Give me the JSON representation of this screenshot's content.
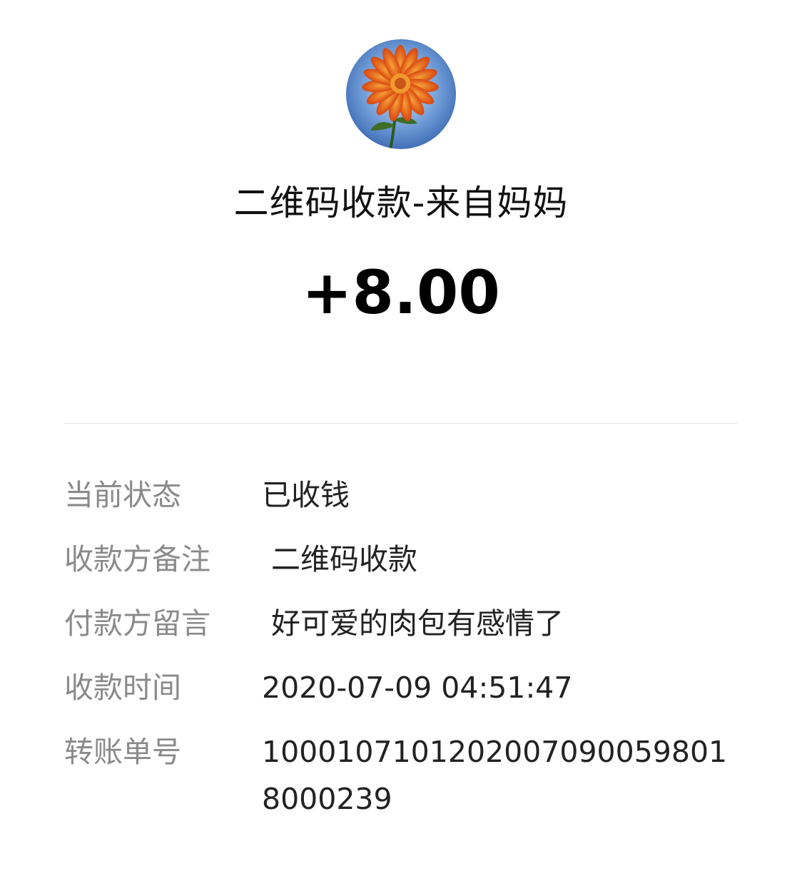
{
  "header": {
    "avatar_icon": "flower-avatar-icon",
    "title": "二维码收款-来自妈妈",
    "amount": "+8.00"
  },
  "details": [
    {
      "label": "当前状态",
      "value": "已收钱"
    },
    {
      "label": "收款方备注",
      "value": " 二维码收款"
    },
    {
      "label": "付款方留言",
      "value": " 好可爱的肉包有感情了"
    },
    {
      "label": "收款时间",
      "value": "2020-07-09 04:51:47"
    },
    {
      "label": "转账单号",
      "value": "1000107101202007090059801 8000239"
    }
  ],
  "colors": {
    "label": "#8a8a8a",
    "value": "#222222",
    "divider": "#e6e6e6",
    "avatar_sky": "#3a6fc4",
    "avatar_petal": "#e8641a"
  }
}
